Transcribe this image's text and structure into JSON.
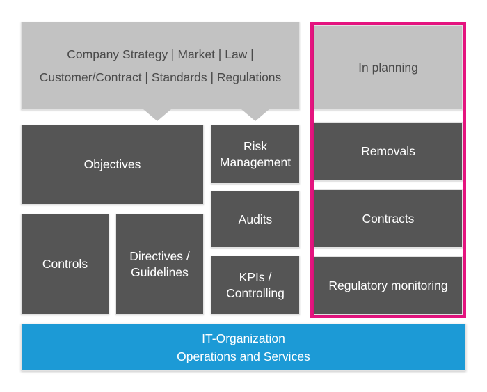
{
  "diagram": {
    "title_context": {
      "lines": [
        "Company Strategy  |  Market  |  Law  |",
        "Customer/Contract  |  Standards  |  Regulations"
      ]
    },
    "planning": {
      "header_label": "In planning",
      "border_color": "#e5147f",
      "items": [
        {
          "label": "Removals"
        },
        {
          "label": "Contracts"
        },
        {
          "label": "Regulatory monitoring"
        }
      ]
    },
    "governance": {
      "objectives_label": "Objectives",
      "controls_label": "Controls",
      "directives_label": "Directives / Guidelines",
      "risk_label": "Risk Management",
      "audits_label": "Audits",
      "kpi_label": "KPIs / Controlling"
    },
    "foundation": {
      "line1": "IT-Organization",
      "line2": "Operations and Services"
    },
    "colors": {
      "light_gray": "#c2c2c2",
      "dark_gray": "#555555",
      "blue": "#1c9ad6",
      "magenta": "#e5147f",
      "text_light": "#4a4a4a",
      "text_white": "#ffffff",
      "background": "#ffffff"
    }
  }
}
